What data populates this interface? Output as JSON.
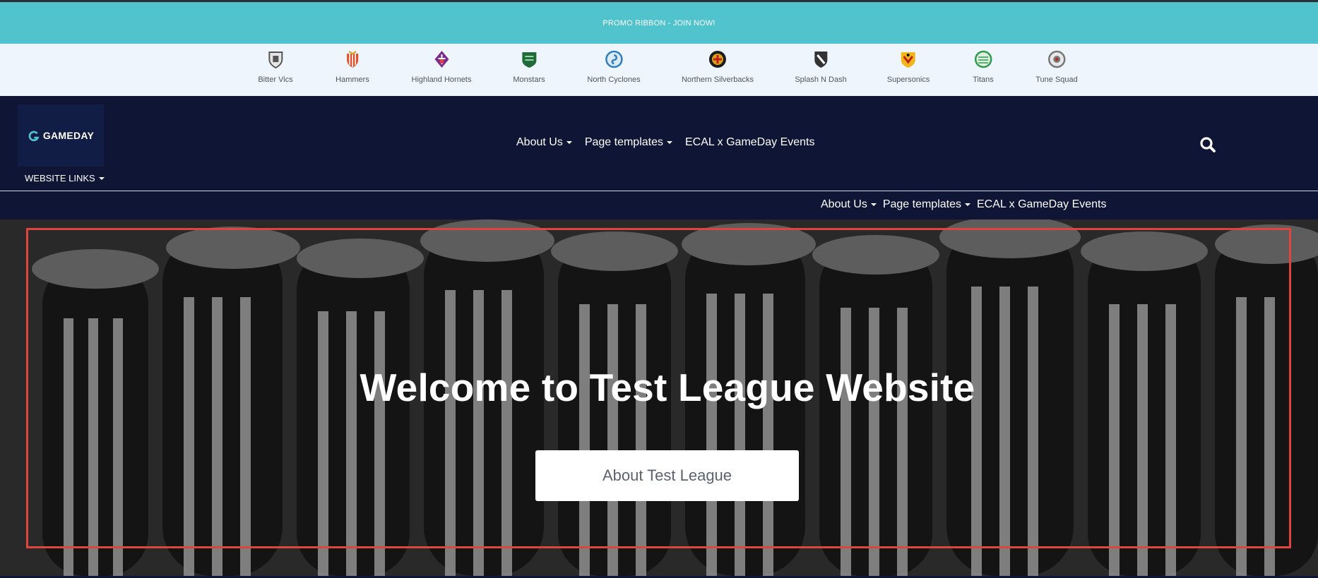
{
  "promo": {
    "text": "PROMO RIBBON - JOIN NOW!"
  },
  "clubs": [
    {
      "name": "Bitter Vics",
      "icon": "shield-crest-icon",
      "color": "#555555"
    },
    {
      "name": "Hammers",
      "icon": "shield-crest-icon",
      "color": "#e0502a"
    },
    {
      "name": "Highland Hornets",
      "icon": "fleur-crest-icon",
      "color": "#7a2c8c"
    },
    {
      "name": "Monstars",
      "icon": "shield-crest-icon",
      "color": "#1f6b3a"
    },
    {
      "name": "North Cyclones",
      "icon": "round-crest-icon",
      "color": "#2f7fc0"
    },
    {
      "name": "Northern Silverbacks",
      "icon": "round-crest-icon",
      "color": "#d8a31a"
    },
    {
      "name": "Splash N Dash",
      "icon": "shield-crest-icon",
      "color": "#333333"
    },
    {
      "name": "Supersonics",
      "icon": "shield-crest-icon",
      "color": "#f2b51a"
    },
    {
      "name": "Titans",
      "icon": "round-crest-icon",
      "color": "#2e9a4a"
    },
    {
      "name": "Tune Squad",
      "icon": "round-crest-icon",
      "color": "#777777"
    }
  ],
  "logo": {
    "text": "GAMEDAY",
    "icon": "gameday-logo-icon"
  },
  "website_links": {
    "label": "WEBSITE LINKS"
  },
  "main_menu": {
    "items": [
      {
        "label": "About Us",
        "dropdown": true
      },
      {
        "label": "Page templates",
        "dropdown": true
      },
      {
        "label": "ECAL x GameDay Events",
        "dropdown": false
      }
    ],
    "search_icon": "search-icon"
  },
  "sub_menu": {
    "items": [
      {
        "label": "About Us",
        "dropdown": true
      },
      {
        "label": "Page templates",
        "dropdown": true
      },
      {
        "label": "ECAL x GameDay Events",
        "dropdown": false
      }
    ]
  },
  "hero": {
    "title": "Welcome to Test League Website",
    "button_label": "About Test League"
  },
  "colors": {
    "promo_bg": "#50c3cc",
    "nav_bg": "#0e1535",
    "hero_frame": "#e0443f"
  }
}
